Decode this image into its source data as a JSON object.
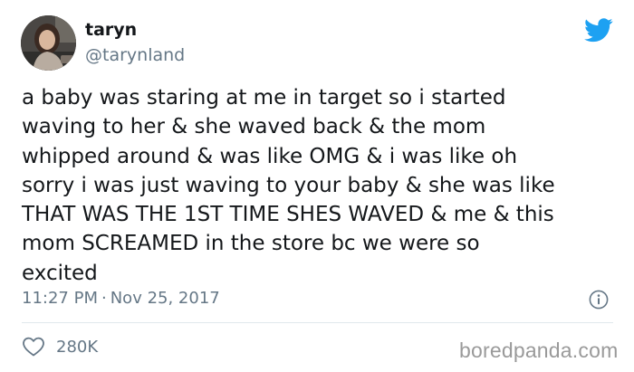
{
  "author": {
    "display_name": "taryn",
    "handle": "@tarynland"
  },
  "tweet": {
    "lines": [
      "a baby was staring at me in target so i started",
      "waving to her & she waved back & the mom",
      "whipped around & was like OMG & i was like oh",
      "sorry i was just waving to your baby & she was like",
      "THAT WAS THE 1ST TIME SHES WAVED & me & this",
      "mom SCREAMED in the store bc we were so",
      "excited"
    ],
    "time": "11:27 PM",
    "separator": "·",
    "date": "Nov 25, 2017"
  },
  "engagement": {
    "like_count": "280K"
  },
  "watermark": "boredpanda.com",
  "colors": {
    "text": "#14171a",
    "secondary": "#657786",
    "twitter_blue": "#1da1f2",
    "divider": "#e1e8ed"
  },
  "icons": {
    "bird": "twitter-bird-icon",
    "info": "info-icon",
    "like": "heart-icon"
  }
}
